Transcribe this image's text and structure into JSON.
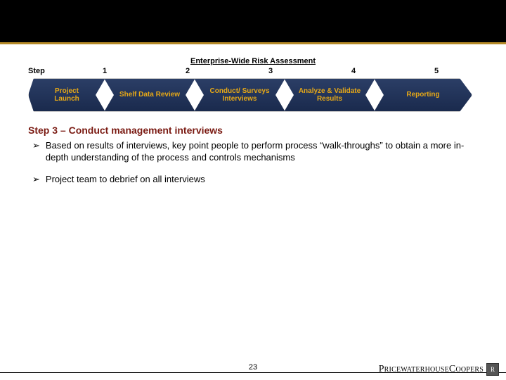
{
  "process": {
    "title": "Enterprise-Wide Risk Assessment",
    "step_label": "Step",
    "step_numbers": [
      "1",
      "2",
      "3",
      "4",
      "5"
    ],
    "steps": [
      "Project Launch",
      "Shelf Data Review",
      "Conduct/ Surveys Interviews",
      "Analyze & Validate Results",
      "Reporting"
    ]
  },
  "heading": "Step 3 – Conduct management interviews",
  "bullets": [
    "Based on results of interviews, key point people to perform process “walk-throughs” to obtain a more in-depth understanding of the process and controls mechanisms",
    "Project team to debrief on all interviews"
  ],
  "colors": {
    "title_bar_accent": "#b58a27",
    "arrow_bg_top": "#2b3e66",
    "arrow_bg_bottom": "#1a2a4d",
    "arrow_text": "#e6a817",
    "heading": "#7a1a12"
  },
  "footer": {
    "page": "23",
    "brand": "PricewaterhouseCoopers",
    "brand_mark": "R"
  }
}
